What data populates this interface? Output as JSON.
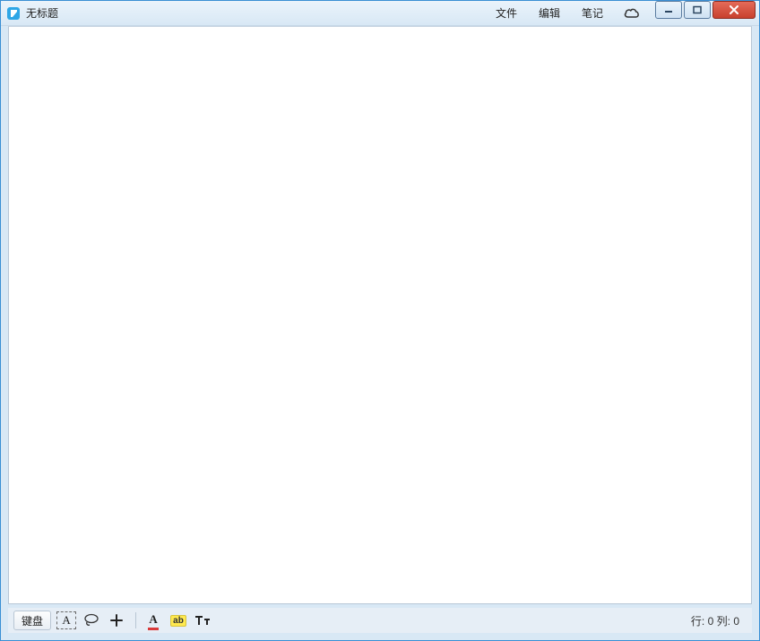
{
  "titlebar": {
    "title": "无标题"
  },
  "menu": {
    "file": "文件",
    "edit": "编辑",
    "note": "笔记"
  },
  "toolbar": {
    "keyboard_label": "键盘",
    "textbox_glyph": "A",
    "fontcolor_glyph": "A",
    "highlight_glyph": "ab"
  },
  "status": {
    "row_label": "行:",
    "row_value": "0",
    "col_label": "列:",
    "col_value": "0"
  }
}
